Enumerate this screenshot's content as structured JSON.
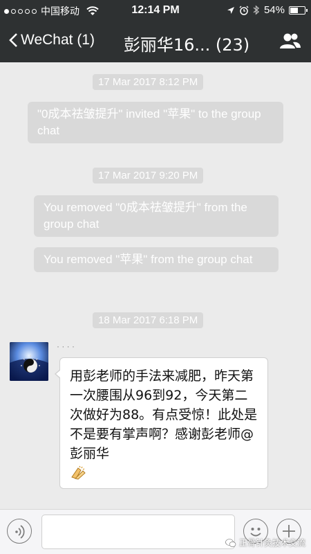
{
  "status_bar": {
    "carrier": "中国移动",
    "time": "12:14 PM",
    "battery": "54%",
    "battery_level": 0.54,
    "icons": [
      "signal-dots-icon",
      "wifi-icon",
      "location-arrow-icon",
      "alarm-icon",
      "bluetooth-icon",
      "battery-icon"
    ]
  },
  "nav": {
    "back_label": "WeChat (1)",
    "title": "彭丽华16... (23)",
    "icons": [
      "back-chevron-icon",
      "group-contacts-icon"
    ]
  },
  "messages": {
    "stamp1": "17 Mar 2017 8:12 PM",
    "sys1": "\"0成本祛皱提升\" invited \"苹果\" to the group chat",
    "stamp2": "17 Mar 2017 9:20 PM",
    "sys2": "You removed \"0成本祛皱提升\" from the group chat",
    "sys3": "You removed \"苹果\" from the group chat",
    "stamp3": "18 Mar 2017 6:18 PM",
    "bubble_text": "用彭老师的手法来减肥，昨天第一次腰围从96到92，今天第二次做好为88。有点受惊！此处是不是要有掌声啊？感谢彭老师@彭丽华"
  },
  "input_bar": {
    "icons": [
      "voice-icon",
      "emoji-icon",
      "plus-icon"
    ]
  },
  "watermark": {
    "text": "正骨针灸技术交流",
    "icon": "wechat-official-icon"
  },
  "colors": {
    "header_bg": "#2e3132",
    "chat_bg": "#ebebeb",
    "system_bubble": "#d9d9d9",
    "bubble_bg": "#ffffff"
  }
}
